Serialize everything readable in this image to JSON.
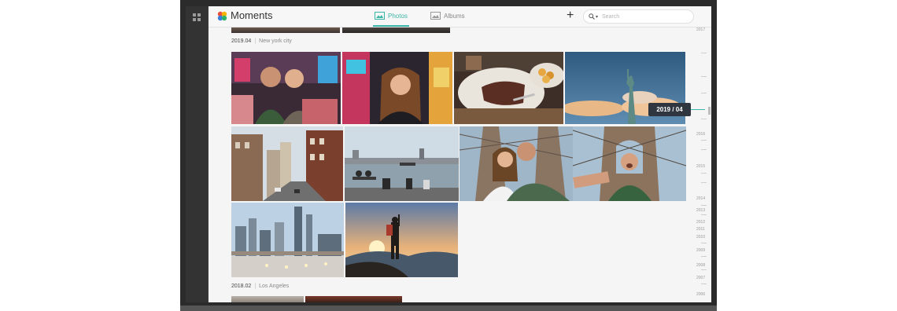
{
  "app": {
    "title": "Moments",
    "accent": "#3ab5a8",
    "tabs": [
      {
        "label": "Photos",
        "icon": "photo-icon",
        "active": true
      },
      {
        "label": "Albums",
        "icon": "album-icon",
        "active": false
      }
    ],
    "add_icon": "plus-icon",
    "search": {
      "placeholder": "Search",
      "icon": "search-icon"
    }
  },
  "sections": [
    {
      "date": "2019.04",
      "place": "New york city"
    },
    {
      "date": "2018.02",
      "place": "Los Angeles"
    }
  ],
  "timeline": {
    "current_label": "2019 / 04",
    "years": [
      "2017",
      "2016",
      "2015",
      "2014",
      "2013",
      "2012",
      "2011",
      "2010",
      "2009",
      "2008",
      "2007",
      "2006"
    ]
  },
  "photos": [
    {
      "subject": "couple selfie in Times Square"
    },
    {
      "subject": "woman selfie with city lights"
    },
    {
      "subject": "steak dinner with fries"
    },
    {
      "subject": "Statue of Liberty"
    },
    {
      "subject": "city street with brick buildings"
    },
    {
      "subject": "people on waterfront bench"
    },
    {
      "subject": "couple selfie on Brooklyn Bridge"
    },
    {
      "subject": "man on Brooklyn Bridge"
    },
    {
      "subject": "Manhattan skyline at dusk"
    },
    {
      "subject": "hiker on mountain at sunset"
    }
  ]
}
